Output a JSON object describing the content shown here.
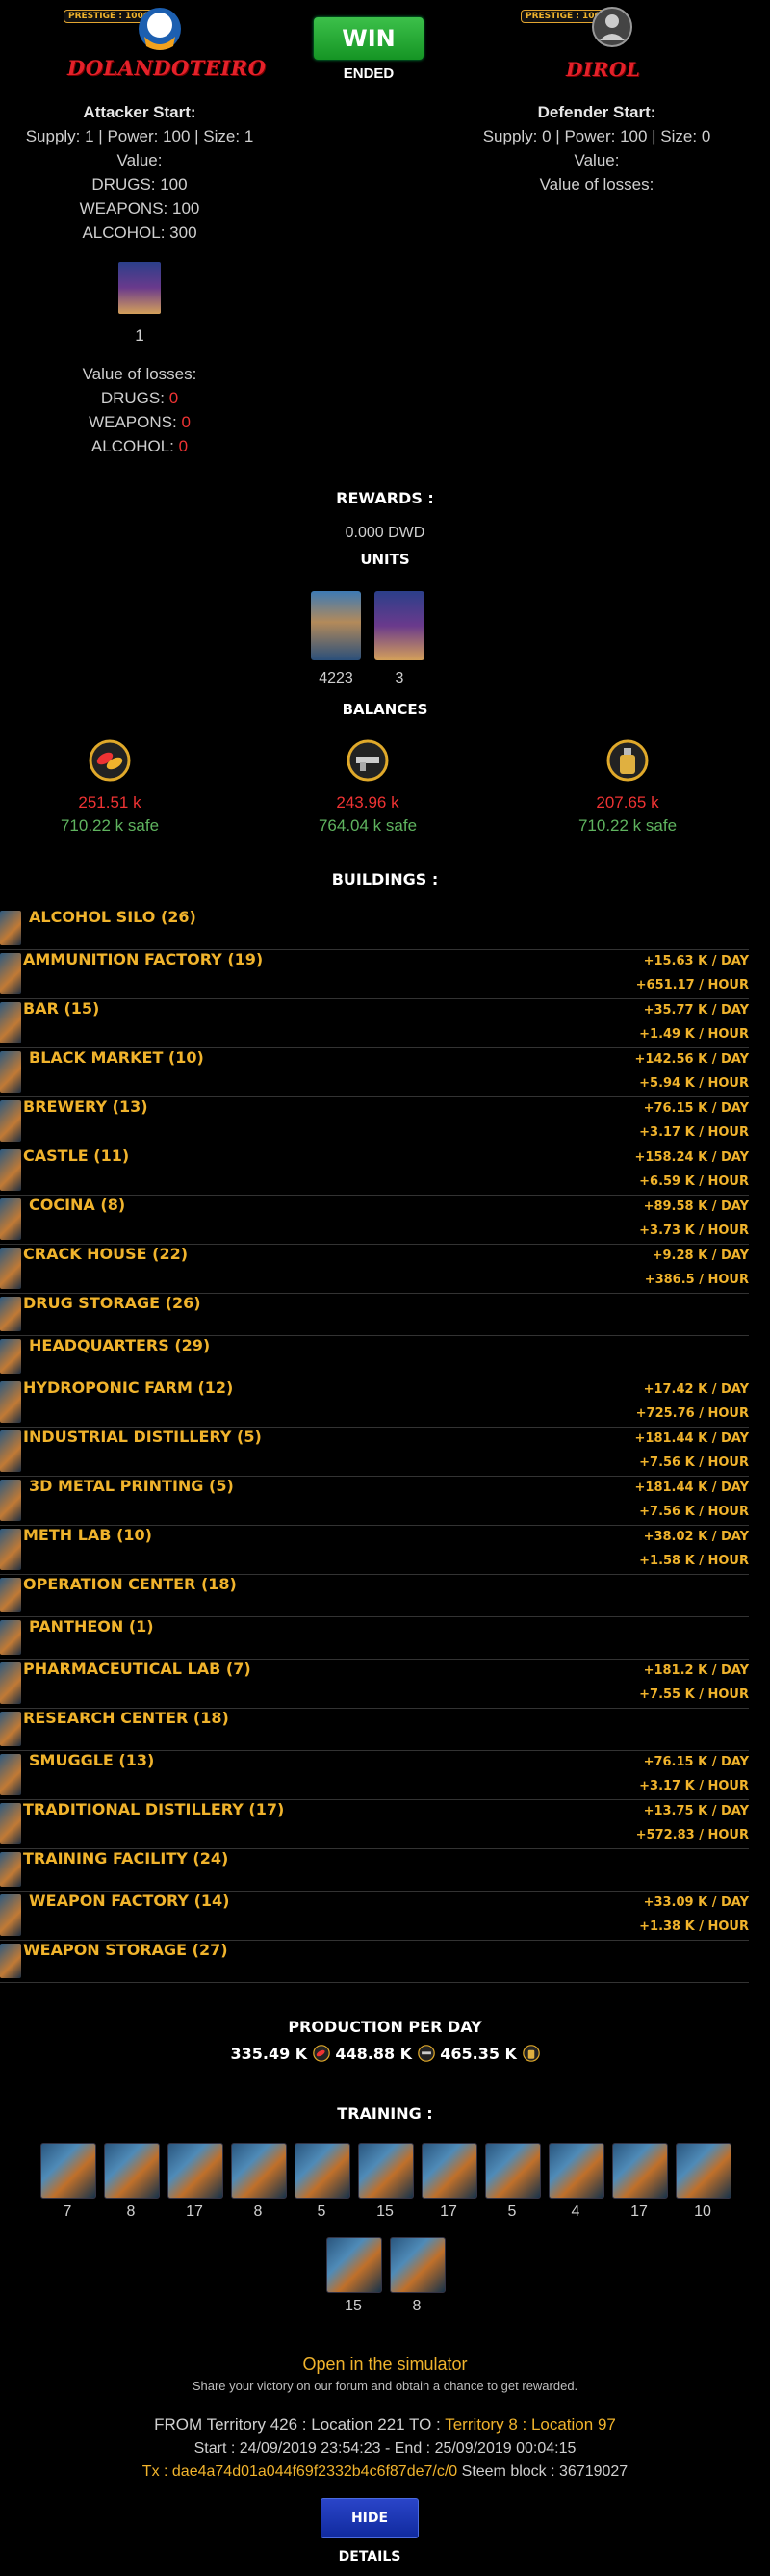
{
  "attacker": {
    "prestige": "PRESTIGE : 1000",
    "name": "DOLANDOTEIRO",
    "start_label": "Attacker Start:",
    "supply_line": "Supply: 1 | Power: 100 | Size: 1",
    "value_label": "Value:",
    "drugs": "DRUGS: 100",
    "weapons": "WEAPONS: 100",
    "alcohol": "ALCOHOL: 300",
    "unit_count": "1",
    "losses_label": "Value of losses:",
    "loss_drugs_label": "DRUGS:",
    "loss_drugs_value": "0",
    "loss_weapons_label": "WEAPONS:",
    "loss_weapons_value": "0",
    "loss_alcohol_label": "ALCOHOL:",
    "loss_alcohol_value": "0"
  },
  "result": {
    "label": "WIN",
    "status": "ENDED"
  },
  "defender": {
    "prestige": "PRESTIGE : 1000",
    "name": "DIROL",
    "start_label": "Defender Start:",
    "supply_line": "Supply: 0 | Power: 100 | Size: 0",
    "value_label": "Value:",
    "losses_label": "Value of losses:"
  },
  "rewards": {
    "title": "REWARDS :",
    "dwd": "0.000 DWD",
    "units_title": "UNITS",
    "units": [
      {
        "icon": "thug-unit-icon",
        "count": "4223"
      },
      {
        "icon": "gangster-unit-icon",
        "count": "3"
      }
    ]
  },
  "balances": {
    "title": "BALANCES",
    "items": [
      {
        "icon": "drugs-icon",
        "amount": "251.51 k",
        "safe": "710.22 k safe"
      },
      {
        "icon": "weapons-icon",
        "amount": "243.96 k",
        "safe": "764.04 k safe"
      },
      {
        "icon": "alcohol-icon",
        "amount": "207.65 k",
        "safe": "710.22 k safe"
      }
    ]
  },
  "buildings": {
    "title": "BUILDINGS :",
    "items": [
      {
        "name": "ALCOHOL SILO (26)",
        "day": "",
        "hour": ""
      },
      {
        "name": "AMMUNITION FACTORY (19)",
        "day": "+15.63 K / DAY",
        "hour": "+651.17 / HOUR"
      },
      {
        "name": "BAR (15)",
        "day": "+35.77 K / DAY",
        "hour": "+1.49 K / HOUR"
      },
      {
        "name": "BLACK MARKET (10)",
        "day": "+142.56 K / DAY",
        "hour": "+5.94 K / HOUR"
      },
      {
        "name": "BREWERY (13)",
        "day": "+76.15 K / DAY",
        "hour": "+3.17 K / HOUR"
      },
      {
        "name": "CASTLE (11)",
        "day": "+158.24 K / DAY",
        "hour": "+6.59 K / HOUR"
      },
      {
        "name": "COCINA (8)",
        "day": "+89.58 K / DAY",
        "hour": "+3.73 K / HOUR"
      },
      {
        "name": "CRACK HOUSE (22)",
        "day": "+9.28 K / DAY",
        "hour": "+386.5 / HOUR"
      },
      {
        "name": "DRUG STORAGE (26)",
        "day": "",
        "hour": ""
      },
      {
        "name": "HEADQUARTERS (29)",
        "day": "",
        "hour": ""
      },
      {
        "name": "HYDROPONIC FARM (12)",
        "day": "+17.42 K / DAY",
        "hour": "+725.76 / HOUR"
      },
      {
        "name": "INDUSTRIAL DISTILLERY (5)",
        "day": "+181.44 K / DAY",
        "hour": "+7.56 K / HOUR"
      },
      {
        "name": "3D METAL PRINTING (5)",
        "day": "+181.44 K / DAY",
        "hour": "+7.56 K / HOUR"
      },
      {
        "name": "METH LAB (10)",
        "day": "+38.02 K / DAY",
        "hour": "+1.58 K / HOUR"
      },
      {
        "name": "OPERATION CENTER (18)",
        "day": "",
        "hour": ""
      },
      {
        "name": "PANTHEON (1)",
        "day": "",
        "hour": ""
      },
      {
        "name": "PHARMACEUTICAL LAB (7)",
        "day": "+181.2 K / DAY",
        "hour": "+7.55 K / HOUR"
      },
      {
        "name": "RESEARCH CENTER (18)",
        "day": "",
        "hour": ""
      },
      {
        "name": "SMUGGLE (13)",
        "day": "+76.15 K / DAY",
        "hour": "+3.17 K / HOUR"
      },
      {
        "name": "TRADITIONAL DISTILLERY (17)",
        "day": "+13.75 K / DAY",
        "hour": "+572.83 / HOUR"
      },
      {
        "name": "TRAINING FACILITY (24)",
        "day": "",
        "hour": ""
      },
      {
        "name": "WEAPON FACTORY (14)",
        "day": "+33.09 K / DAY",
        "hour": "+1.38 K / HOUR"
      },
      {
        "name": "WEAPON STORAGE (27)",
        "day": "",
        "hour": ""
      }
    ]
  },
  "production": {
    "title": "PRODUCTION PER DAY",
    "drugs": "335.49 K",
    "weapons": "448.88 K",
    "alcohol": "465.35 K"
  },
  "training": {
    "title": "TRAINING :",
    "row1": [
      "7",
      "8",
      "17",
      "8",
      "5",
      "15",
      "17",
      "5",
      "4",
      "17",
      "10"
    ],
    "row2": [
      "15",
      "8"
    ]
  },
  "footer": {
    "simulator_link": "Open in the simulator",
    "share_text": "Share your victory on our forum and obtain a chance to get rewarded.",
    "from_text": "FROM Territory 426 : Location 221 TO :",
    "to_text": "Territory 8 : Location 97",
    "times": "Start : 24/09/2019 23:54:23 - End : 25/09/2019 00:04:15",
    "tx_label": "Tx : dae4a74d01a044f69f2332b4c6f87de7/c/0",
    "steem_block": "Steem block : 36719027",
    "hide_button": "HIDE DETAILS"
  },
  "colors": {
    "gold": "#f0b32c",
    "loss_red": "#e33333",
    "safe_green": "#5fb35f",
    "win_green": "#1fa52e",
    "button_blue": "#1a36b8"
  }
}
